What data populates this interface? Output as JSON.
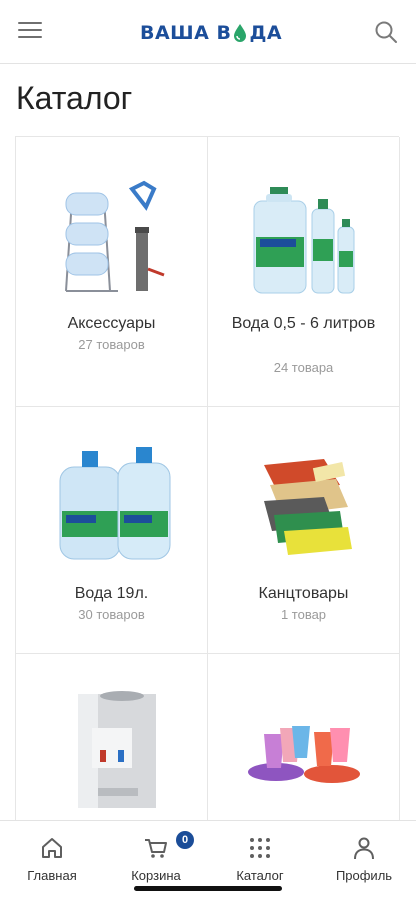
{
  "header": {
    "logo_left": "ВАША В",
    "logo_right": "ДА"
  },
  "page": {
    "title": "Каталог"
  },
  "catalog": [
    {
      "title": "Аксессуары",
      "count": "27 товаров"
    },
    {
      "title": "Вода 0,5 - 6 литров",
      "count": "24 товара"
    },
    {
      "title": "Вода 19л.",
      "count": "30 товаров"
    },
    {
      "title": "Канцтовары",
      "count": "1 товар"
    },
    {
      "title": "",
      "count": ""
    },
    {
      "title": "",
      "count": ""
    }
  ],
  "bottom_nav": {
    "items": [
      {
        "label": "Главная",
        "icon": "home-icon"
      },
      {
        "label": "Корзина",
        "icon": "cart-icon"
      },
      {
        "label": "Каталог",
        "icon": "grid-icon"
      },
      {
        "label": "Профиль",
        "icon": "user-icon"
      }
    ],
    "cart_badge": "0"
  },
  "colors": {
    "brand": "#1c4e9a",
    "badge": "#1b4d98",
    "drop": "#2aa56a"
  }
}
